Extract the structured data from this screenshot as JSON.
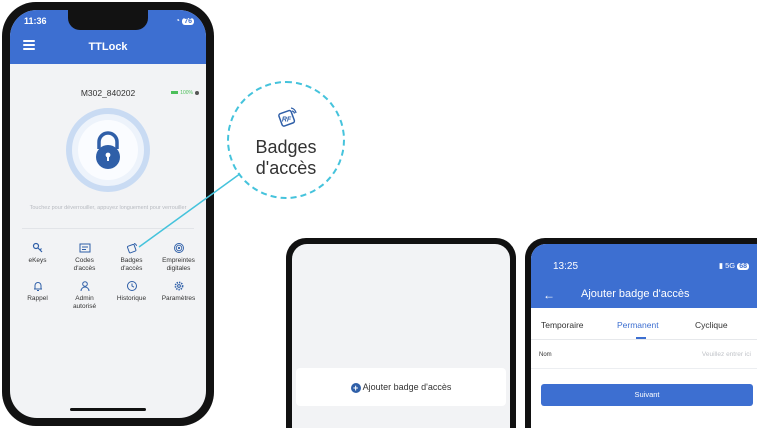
{
  "phone1": {
    "time": "11:36",
    "status_signal": "•",
    "battery": "76",
    "app_title": "TTLock",
    "device_name": "M302_840202",
    "battery_level": "100%",
    "hint": "Touchez pour déverrouiller, appuyez longuement pour verrouiller",
    "menu": [
      {
        "label": "eKeys",
        "icon": "ekey-icon"
      },
      {
        "label": "Codes\nd'accès",
        "icon": "passcode-icon"
      },
      {
        "label": "Badges\nd'accès",
        "icon": "rf-card-icon"
      },
      {
        "label": "Empreintes\ndigitales",
        "icon": "fingerprint-icon"
      },
      {
        "label": "Rappel",
        "icon": "bell-icon"
      },
      {
        "label": "Admin\nautorisé",
        "icon": "admin-icon"
      },
      {
        "label": "Historique",
        "icon": "history-icon"
      },
      {
        "label": "Paramètres",
        "icon": "settings-icon"
      }
    ]
  },
  "callout": {
    "icon_text": "RF",
    "line1": "Badges",
    "line2": "d'accès"
  },
  "panel2": {
    "add_label": "Ajouter badge d'accès"
  },
  "panel3": {
    "time": "13:25",
    "network": "5G",
    "battery": "68",
    "back": "←",
    "title": "Ajouter badge d'accès",
    "tabs": [
      "Temporaire",
      "Permanent",
      "Cyclique"
    ],
    "active_tab": "Permanent",
    "field_label": "Nom",
    "field_placeholder": "Veuillez entrer ici",
    "next_label": "Suivant"
  },
  "colors": {
    "primary": "#3d6fd1",
    "accent_callout": "#45c3dc"
  }
}
